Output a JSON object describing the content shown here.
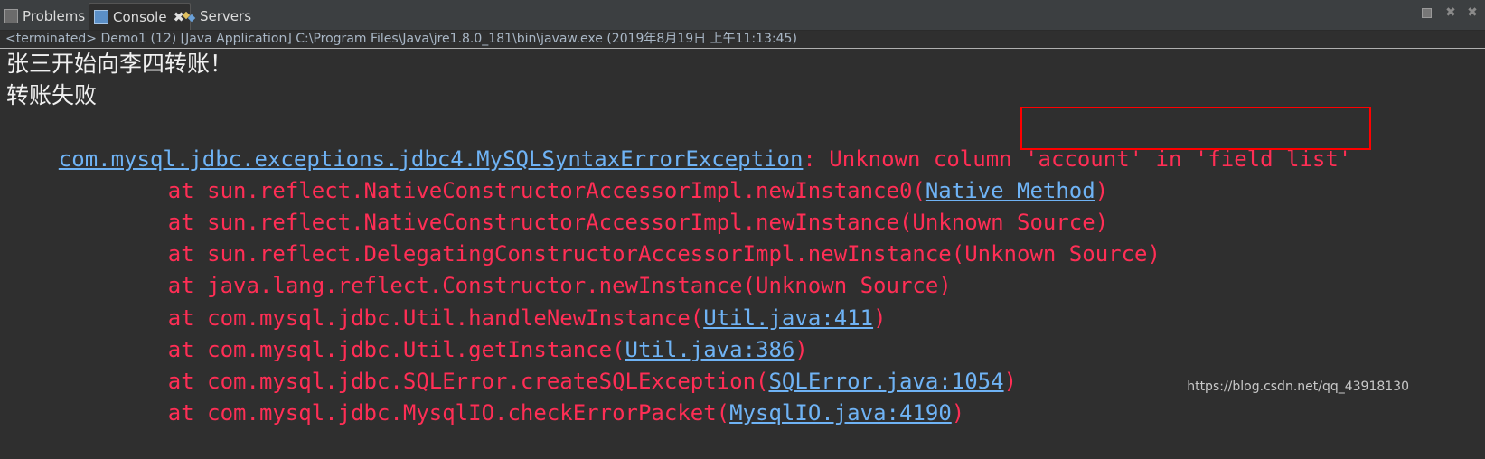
{
  "tabs": [
    {
      "label": "Problems",
      "icon": "problems-icon"
    },
    {
      "label": "Console",
      "icon": "console-icon",
      "active": true
    },
    {
      "label": "Servers",
      "icon": "servers-icon"
    }
  ],
  "toolbar": {
    "stop_icon": "stop-icon",
    "remove_icon": "remove-launch-icon",
    "remove_all_icon": "remove-all-icon"
  },
  "status": "<terminated> Demo1 (12) [Java Application] C:\\Program Files\\Java\\jre1.8.0_181\\bin\\javaw.exe (2019年8月19日 上午11:13:45)",
  "output": {
    "line1": "张三开始向李四转账！",
    "line2": "转账失败",
    "exception_class": "com.mysql.jdbc.exceptions.jdbc4.MySQLSyntaxErrorException",
    "exception_msg_a": ": Unknown column ",
    "exception_msg_b": "'account' in 'field list'",
    "frames": [
      {
        "prefix": "at sun.reflect.NativeConstructorAccessorImpl.newInstance0(",
        "link": "Native Method",
        "suffix": ")"
      },
      {
        "prefix": "at sun.reflect.NativeConstructorAccessorImpl.newInstance(Unknown Source)",
        "link": "",
        "suffix": ""
      },
      {
        "prefix": "at sun.reflect.DelegatingConstructorAccessorImpl.newInstance(Unknown Source)",
        "link": "",
        "suffix": ""
      },
      {
        "prefix": "at java.lang.reflect.Constructor.newInstance(Unknown Source)",
        "link": "",
        "suffix": ""
      },
      {
        "prefix": "at com.mysql.jdbc.Util.handleNewInstance(",
        "link": "Util.java:411",
        "suffix": ")"
      },
      {
        "prefix": "at com.mysql.jdbc.Util.getInstance(",
        "link": "Util.java:386",
        "suffix": ")"
      },
      {
        "prefix": "at com.mysql.jdbc.SQLError.createSQLException(",
        "link": "SQLError.java:1054",
        "suffix": ")"
      },
      {
        "prefix": "at com.mysql.jdbc.MysqlIO.checkErrorPacket(",
        "link": "MysqlIO.java:4190",
        "suffix": ")"
      }
    ]
  },
  "watermark": "https://blog.csdn.net/qq_43918130",
  "colors": {
    "background": "#2f2f2f",
    "error": "#ff2e55",
    "link": "#6fb3f5",
    "highlight": "#ff0000"
  }
}
